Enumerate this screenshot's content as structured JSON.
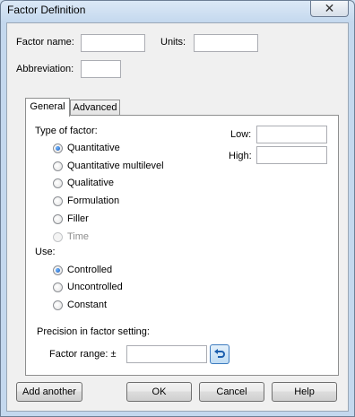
{
  "window": {
    "title": "Factor Definition",
    "close_glyph": "✕"
  },
  "top": {
    "factor_name_label": "Factor name:",
    "factor_name_value": "",
    "units_label": "Units:",
    "units_value": "",
    "abbreviation_label": "Abbreviation:",
    "abbreviation_value": ""
  },
  "tabs": [
    {
      "label": "General",
      "active": true
    },
    {
      "label": "Advanced",
      "active": false
    }
  ],
  "general": {
    "type_label": "Type of factor:",
    "types": [
      {
        "label": "Quantitative",
        "checked": true,
        "disabled": false
      },
      {
        "label": "Quantitative multilevel",
        "checked": false,
        "disabled": false
      },
      {
        "label": "Qualitative",
        "checked": false,
        "disabled": false
      },
      {
        "label": "Formulation",
        "checked": false,
        "disabled": false
      },
      {
        "label": "Filler",
        "checked": false,
        "disabled": false
      },
      {
        "label": "Time",
        "checked": false,
        "disabled": true
      }
    ],
    "low_label": "Low:",
    "low_value": "",
    "high_label": "High:",
    "high_value": "",
    "use_label": "Use:",
    "uses": [
      {
        "label": "Controlled",
        "checked": true
      },
      {
        "label": "Uncontrolled",
        "checked": false
      },
      {
        "label": "Constant",
        "checked": false
      }
    ],
    "precision_label": "Precision in factor setting:",
    "factor_range_label": "Factor range: ±",
    "factor_range_value": "",
    "reset_icon": "undo-arrow-icon"
  },
  "buttons": {
    "add_another": "Add another",
    "ok": "OK",
    "cancel": "Cancel",
    "help": "Help"
  }
}
